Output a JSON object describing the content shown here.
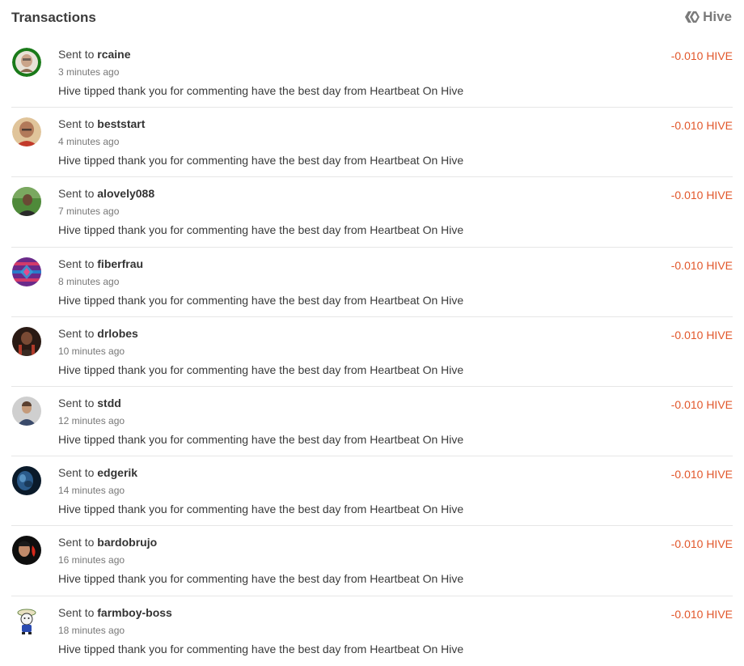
{
  "header": {
    "title": "Transactions",
    "brand_label": "Hive"
  },
  "colors": {
    "amount": "#e2572b",
    "divider": "#e6e6e6"
  },
  "transactions": [
    {
      "prefix": "Sent to",
      "user": "rcaine",
      "time": "3 minutes ago",
      "memo": "Hive tipped thank you for commenting have the best day from Heartbeat On Hive",
      "amount": "-0.010 HIVE",
      "avatar": "avatar-green-portrait"
    },
    {
      "prefix": "Sent to",
      "user": "beststart",
      "time": "4 minutes ago",
      "memo": "Hive tipped thank you for commenting have the best day from Heartbeat On Hive",
      "amount": "-0.010 HIVE",
      "avatar": "avatar-bald-man"
    },
    {
      "prefix": "Sent to",
      "user": "alovely088",
      "time": "7 minutes ago",
      "memo": "Hive tipped thank you for commenting have the best day from Heartbeat On Hive",
      "amount": "-0.010 HIVE",
      "avatar": "avatar-outdoor-man"
    },
    {
      "prefix": "Sent to",
      "user": "fiberfrau",
      "time": "8 minutes ago",
      "memo": "Hive tipped thank you for commenting have the best day from Heartbeat On Hive",
      "amount": "-0.010 HIVE",
      "avatar": "avatar-pattern"
    },
    {
      "prefix": "Sent to",
      "user": "drlobes",
      "time": "10 minutes ago",
      "memo": "Hive tipped thank you for commenting have the best day from Heartbeat On Hive",
      "amount": "-0.010 HIVE",
      "avatar": "avatar-dark-portrait"
    },
    {
      "prefix": "Sent to",
      "user": "stdd",
      "time": "12 minutes ago",
      "memo": "Hive tipped thank you for commenting have the best day from Heartbeat On Hive",
      "amount": "-0.010 HIVE",
      "avatar": "avatar-grey-man"
    },
    {
      "prefix": "Sent to",
      "user": "edgerik",
      "time": "14 minutes ago",
      "memo": "Hive tipped thank you for commenting have the best day from Heartbeat On Hive",
      "amount": "-0.010 HIVE",
      "avatar": "avatar-blue-face"
    },
    {
      "prefix": "Sent to",
      "user": "bardobrujo",
      "time": "16 minutes ago",
      "memo": "Hive tipped thank you for commenting have the best day from Heartbeat On Hive",
      "amount": "-0.010 HIVE",
      "avatar": "avatar-red-flame"
    },
    {
      "prefix": "Sent to",
      "user": "farmboy-boss",
      "time": "18 minutes ago",
      "memo": "Hive tipped thank you for commenting have the best day from Heartbeat On Hive",
      "amount": "-0.010 HIVE",
      "avatar": "avatar-cartoon"
    }
  ]
}
